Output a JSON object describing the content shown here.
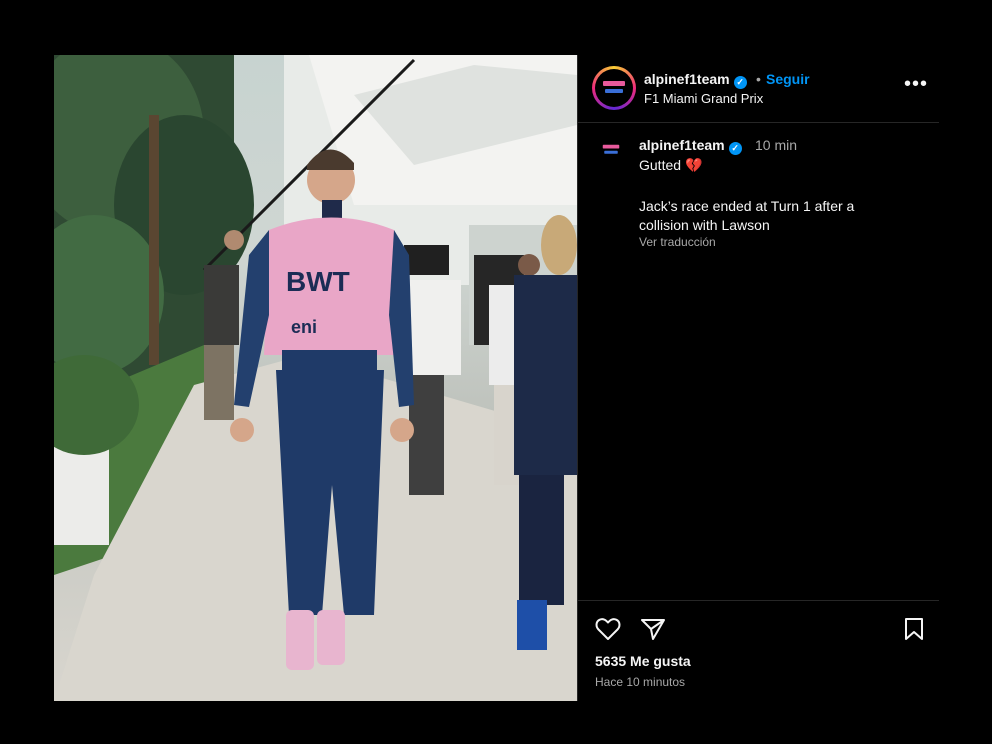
{
  "post": {
    "image": {
      "suit_brand": "BWT",
      "sponsor": "eni"
    },
    "header": {
      "username": "alpinef1team",
      "separator": "•",
      "follow_label": "Seguir",
      "location": "F1 Miami Grand Prix",
      "more_label": "•••"
    },
    "caption": {
      "username": "alpinef1team",
      "time": "10 min",
      "line1": "Gutted",
      "body": "Jack’s race ended at Turn 1 after a collision with Lawson",
      "translate_label": "Ver traducción"
    },
    "actions": {
      "likes": "5635 Me gusta",
      "time_ago": "Hace 10 minutos"
    },
    "icons": [
      "heart-icon",
      "share-icon",
      "bookmark-icon",
      "verified-icon",
      "more-icon",
      "broken-heart-icon"
    ],
    "colors": {
      "background": "#000000",
      "accent": "#0095f6",
      "suit_pink": "#e9a6c7",
      "suit_blue": "#1f3a68"
    }
  }
}
